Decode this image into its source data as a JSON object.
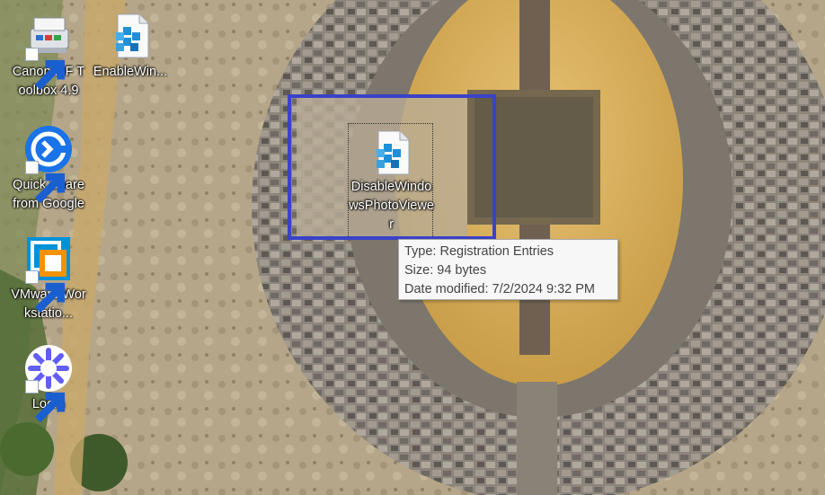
{
  "desktop": {
    "icons": [
      {
        "label": "Canon MF Toolbox 4.9",
        "icon": "canon-toolbox-icon",
        "shortcut": true
      },
      {
        "label": "EnableWin...",
        "icon": "registry-file-icon",
        "shortcut": false
      },
      {
        "label": "Quick Share from Google",
        "icon": "quick-share-icon",
        "shortcut": true
      },
      {
        "label": "VMware Workstatio...",
        "icon": "vmware-icon",
        "shortcut": true
      },
      {
        "label": "Loom",
        "icon": "loom-icon",
        "shortcut": true
      }
    ],
    "selected_icon": {
      "label": "DisableWindowsPhotoViewer",
      "icon": "registry-file-icon"
    }
  },
  "tooltip": {
    "type": "Type: Registration Entries",
    "size": "Size: 94 bytes",
    "modified": "Date modified: 7/2/2024 9:32 PM"
  },
  "colors": {
    "selection_rect": "#3a42c8",
    "quick_share_blue": "#1a73e8",
    "loom_purple": "#625df5",
    "vmware_orange": "#f39200",
    "vmware_blue": "#0091da"
  }
}
